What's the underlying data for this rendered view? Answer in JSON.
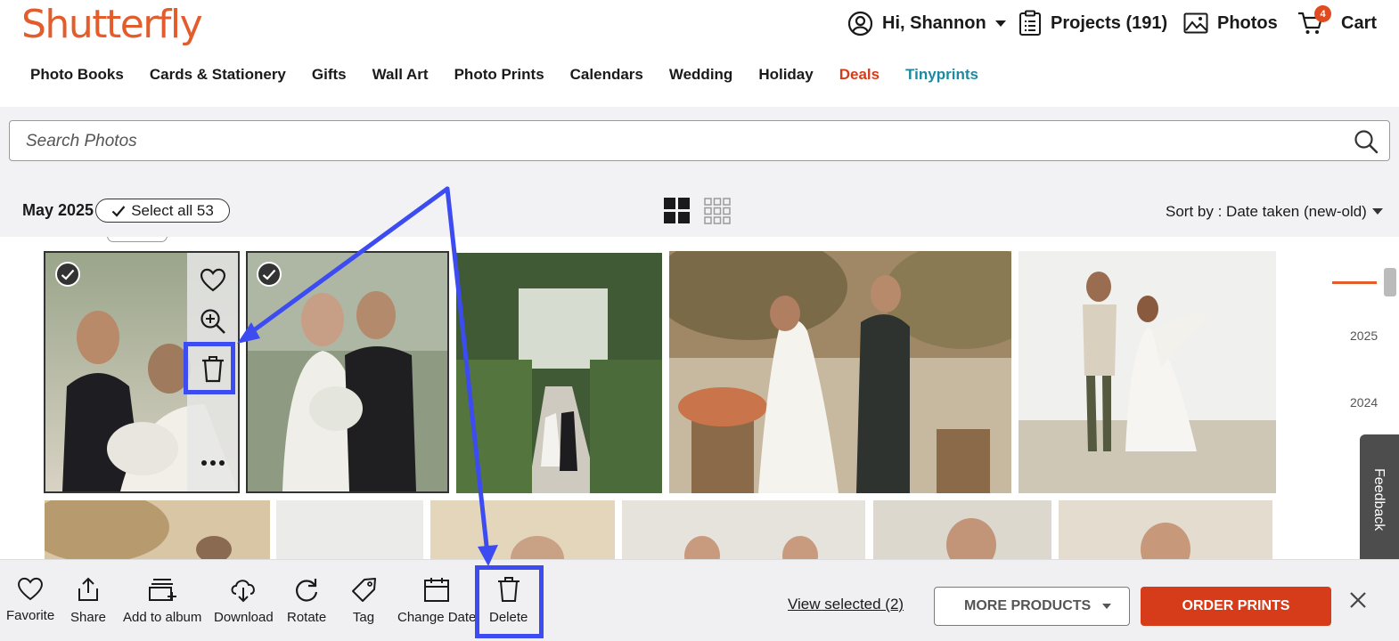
{
  "header": {
    "logo": "Shutterfly",
    "user_greeting": "Hi, Shannon",
    "projects_label": "Projects",
    "projects_count": "(191)",
    "photos_label": "Photos",
    "cart_label": "Cart",
    "cart_badge": "4"
  },
  "nav": {
    "items": [
      "Photo Books",
      "Cards & Stationery",
      "Gifts",
      "Wall Art",
      "Photo Prints",
      "Calendars",
      "Wedding",
      "Holiday",
      "Deals",
      "Tinyprints"
    ]
  },
  "search": {
    "placeholder": "Search Photos"
  },
  "toolbar": {
    "month": "May 2025",
    "select_all": "Select all 53",
    "sort_prefix": "Sort by :",
    "sort_value": "Date taken (new-old)"
  },
  "timeline": {
    "years": [
      "2025",
      "2024"
    ]
  },
  "feedback": "Feedback",
  "actions": {
    "items": [
      "Favorite",
      "Share",
      "Add to album",
      "Download",
      "Rotate",
      "Tag",
      "Change Date",
      "Delete"
    ],
    "view_selected": "View selected (2)",
    "more_products": "MORE PRODUCTS",
    "order_prints": "ORDER PRINTS"
  },
  "colors": {
    "brand": "#e35d2c",
    "accent_order": "#d63c1a",
    "tinyprints": "#1b8aa0",
    "annotation": "#3d4cf0"
  }
}
